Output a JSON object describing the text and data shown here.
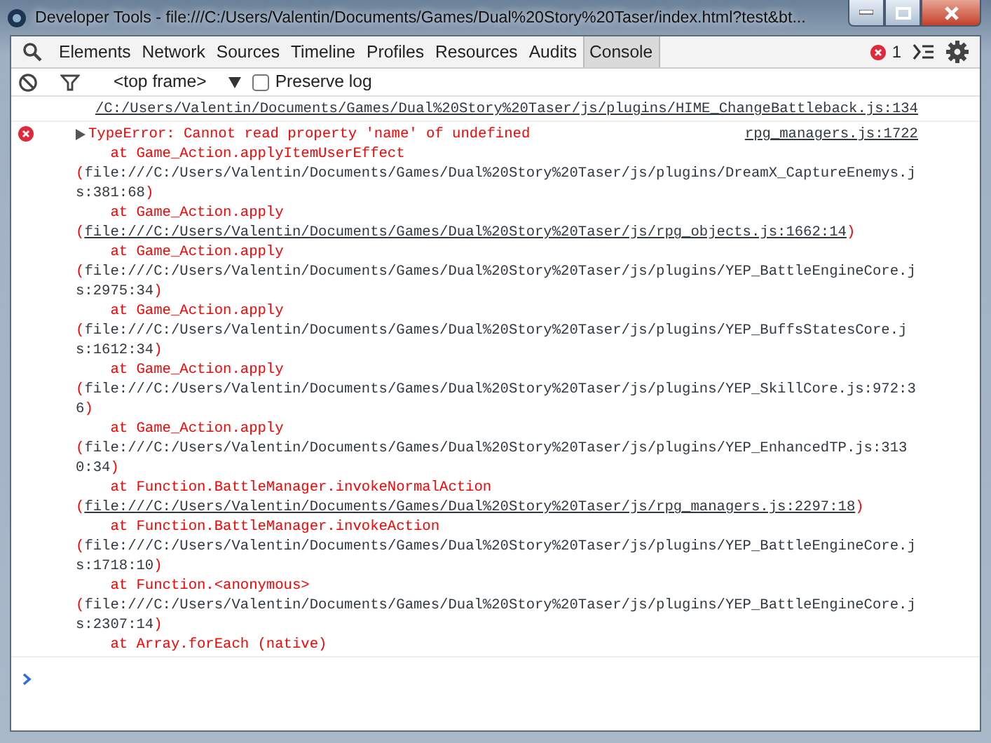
{
  "window": {
    "title": "Developer Tools - file:///C:/Users/Valentin/Documents/Games/Dual%20Story%20Taser/index.html?test&bt..."
  },
  "tabs": [
    {
      "label": "Elements",
      "selected": false
    },
    {
      "label": "Network",
      "selected": false
    },
    {
      "label": "Sources",
      "selected": false
    },
    {
      "label": "Timeline",
      "selected": false
    },
    {
      "label": "Profiles",
      "selected": false
    },
    {
      "label": "Resources",
      "selected": false
    },
    {
      "label": "Audits",
      "selected": false
    },
    {
      "label": "Console",
      "selected": true
    }
  ],
  "error_count": "1",
  "toolbar": {
    "context": "<top frame>",
    "preserve_log": {
      "label": "Preserve log",
      "checked": false
    }
  },
  "messages": [
    {
      "kind": "log",
      "source": "/C:/Users/Valentin/Documents/Games/Dual%20Story%20Taser/js/plugins/HIME_ChangeBattleback.js:134"
    },
    {
      "kind": "error",
      "expanded": false,
      "message": "TypeError: Cannot read property 'name' of undefined",
      "source": "rpg_managers.js:1722",
      "stack": [
        {
          "kind": "frame",
          "text": "at Game_Action.applyItemUserEffect"
        },
        {
          "kind": "location",
          "open": "(",
          "path": "file:///C:/Users/Valentin/Documents/Games/Dual%20Story%20Taser/js/plugins/DreamX_CaptureEnemys.js:381:68",
          "close": ")",
          "linked": false
        },
        {
          "kind": "frame",
          "text": "at Game_Action.apply"
        },
        {
          "kind": "location",
          "open": "(",
          "path": "file:///C:/Users/Valentin/Documents/Games/Dual%20Story%20Taser/js/rpg_objects.js:1662:14",
          "close": ")",
          "linked": true
        },
        {
          "kind": "frame",
          "text": "at Game_Action.apply"
        },
        {
          "kind": "location",
          "open": "(",
          "path": "file:///C:/Users/Valentin/Documents/Games/Dual%20Story%20Taser/js/plugins/YEP_BattleEngineCore.js:2975:34",
          "close": ")",
          "linked": false
        },
        {
          "kind": "frame",
          "text": "at Game_Action.apply"
        },
        {
          "kind": "location",
          "open": "(",
          "path": "file:///C:/Users/Valentin/Documents/Games/Dual%20Story%20Taser/js/plugins/YEP_BuffsStatesCore.js:1612:34",
          "close": ")",
          "linked": false
        },
        {
          "kind": "frame",
          "text": "at Game_Action.apply"
        },
        {
          "kind": "location",
          "open": "(",
          "path": "file:///C:/Users/Valentin/Documents/Games/Dual%20Story%20Taser/js/plugins/YEP_SkillCore.js:972:36",
          "close": ")",
          "linked": false
        },
        {
          "kind": "frame",
          "text": "at Game_Action.apply"
        },
        {
          "kind": "location",
          "open": "(",
          "path": "file:///C:/Users/Valentin/Documents/Games/Dual%20Story%20Taser/js/plugins/YEP_EnhancedTP.js:3130:34",
          "close": ")",
          "linked": false
        },
        {
          "kind": "frame",
          "text": "at Function.BattleManager.invokeNormalAction"
        },
        {
          "kind": "location",
          "open": "(",
          "path": "file:///C:/Users/Valentin/Documents/Games/Dual%20Story%20Taser/js/rpg_managers.js:2297:18",
          "close": ")",
          "linked": true
        },
        {
          "kind": "frame",
          "text": "at Function.BattleManager.invokeAction"
        },
        {
          "kind": "location",
          "open": "(",
          "path": "file:///C:/Users/Valentin/Documents/Games/Dual%20Story%20Taser/js/plugins/YEP_BattleEngineCore.js:1718:10",
          "close": ")",
          "linked": false
        },
        {
          "kind": "frame",
          "text": "at Function.<anonymous>"
        },
        {
          "kind": "location",
          "open": "(",
          "path": "file:///C:/Users/Valentin/Documents/Games/Dual%20Story%20Taser/js/plugins/YEP_BattleEngineCore.js:2307:14",
          "close": ")",
          "linked": false
        },
        {
          "kind": "frame",
          "text": "at Array.forEach (native)"
        }
      ]
    }
  ]
}
